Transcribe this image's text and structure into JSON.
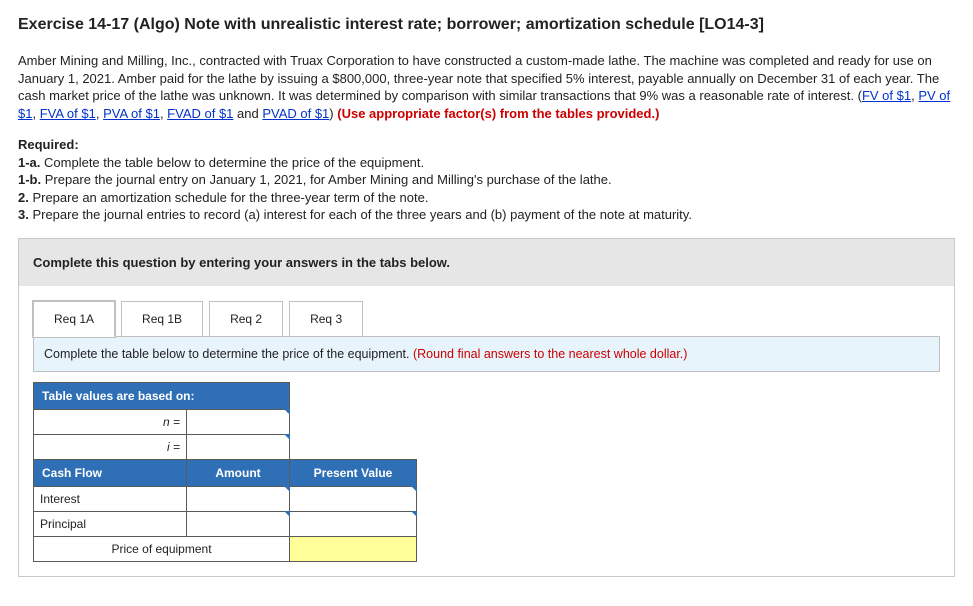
{
  "title": "Exercise 14-17 (Algo) Note with unrealistic interest rate; borrower; amortization schedule [LO14-3]",
  "problem": {
    "text_before_links": "Amber Mining and Milling, Inc., contracted with Truax Corporation to have constructed a custom-made lathe. The machine was completed and ready for use on January 1, 2021. Amber paid for the lathe by issuing a $800,000, three-year note that specified 5% interest, payable annually on December 31 of each year. The cash market price of the lathe was unknown. It was determined by comparison with similar transactions that 9% was a reasonable rate of interest. (",
    "links": {
      "fv": "FV of $1",
      "pv": "PV of $1",
      "fva": "FVA of $1",
      "pva": "PVA of $1",
      "fvad": "FVAD of $1",
      "pvad": "PVAD of $1"
    },
    "sep": ", ",
    "and_word": " and ",
    "after_links": ") ",
    "use_factors": "(Use appropriate factor(s) from the tables provided.)"
  },
  "required": {
    "heading": "Required:",
    "items": {
      "a": {
        "num": "1-a.",
        "text": " Complete the table below to determine the price of the equipment."
      },
      "b": {
        "num": "1-b.",
        "text": " Prepare the journal entry on January 1, 2021, for Amber Mining and Milling's purchase of the lathe."
      },
      "c": {
        "num": "2.",
        "text": " Prepare an amortization schedule for the three-year term of the note."
      },
      "d": {
        "num": "3.",
        "text": " Prepare the journal entries to record (a) interest for each of the three years and (b) payment of the note at maturity."
      }
    }
  },
  "qbox": {
    "header": "Complete this question by entering your answers in the tabs below.",
    "tabs": {
      "t1": "Req 1A",
      "t2": "Req 1B",
      "t3": "Req 2",
      "t4": "Req 3"
    },
    "instruction": "Complete the table below to determine the price of the equipment. ",
    "instruction_hint": "(Round final answers to the nearest whole dollar.)"
  },
  "table": {
    "header_span": "Table values are based on:",
    "n_label": "n =",
    "i_label": "i =",
    "col_cashflow": "Cash Flow",
    "col_amount": "Amount",
    "col_pv": "Present Value",
    "row_interest": "Interest",
    "row_principal": "Principal",
    "footer": "Price of equipment"
  }
}
